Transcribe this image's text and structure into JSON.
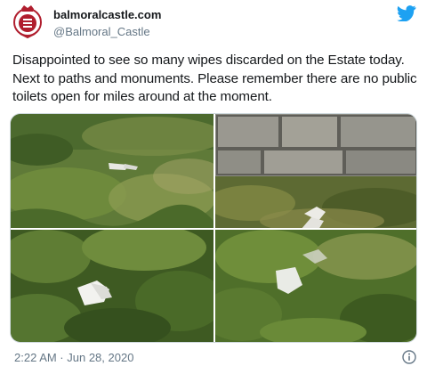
{
  "account": {
    "display_name": "balmoralcastle.com",
    "handle": "@Balmoral_Castle"
  },
  "tweet": {
    "text": "Disappointed to see so many wipes discarded on the Estate today. Next to paths and monuments. Please remember there are no public toilets open for miles around at the moment."
  },
  "footer": {
    "timestamp": "2:22 AM · Jun 28, 2020"
  },
  "icons": {
    "avatar": "crest-logo-icon",
    "brand": "twitter-bird-icon",
    "info": "info-icon"
  },
  "colors": {
    "brand_blue": "#1da1f2",
    "crest_red": "#b01e2e",
    "text_primary": "#14171a",
    "text_secondary": "#657786"
  }
}
